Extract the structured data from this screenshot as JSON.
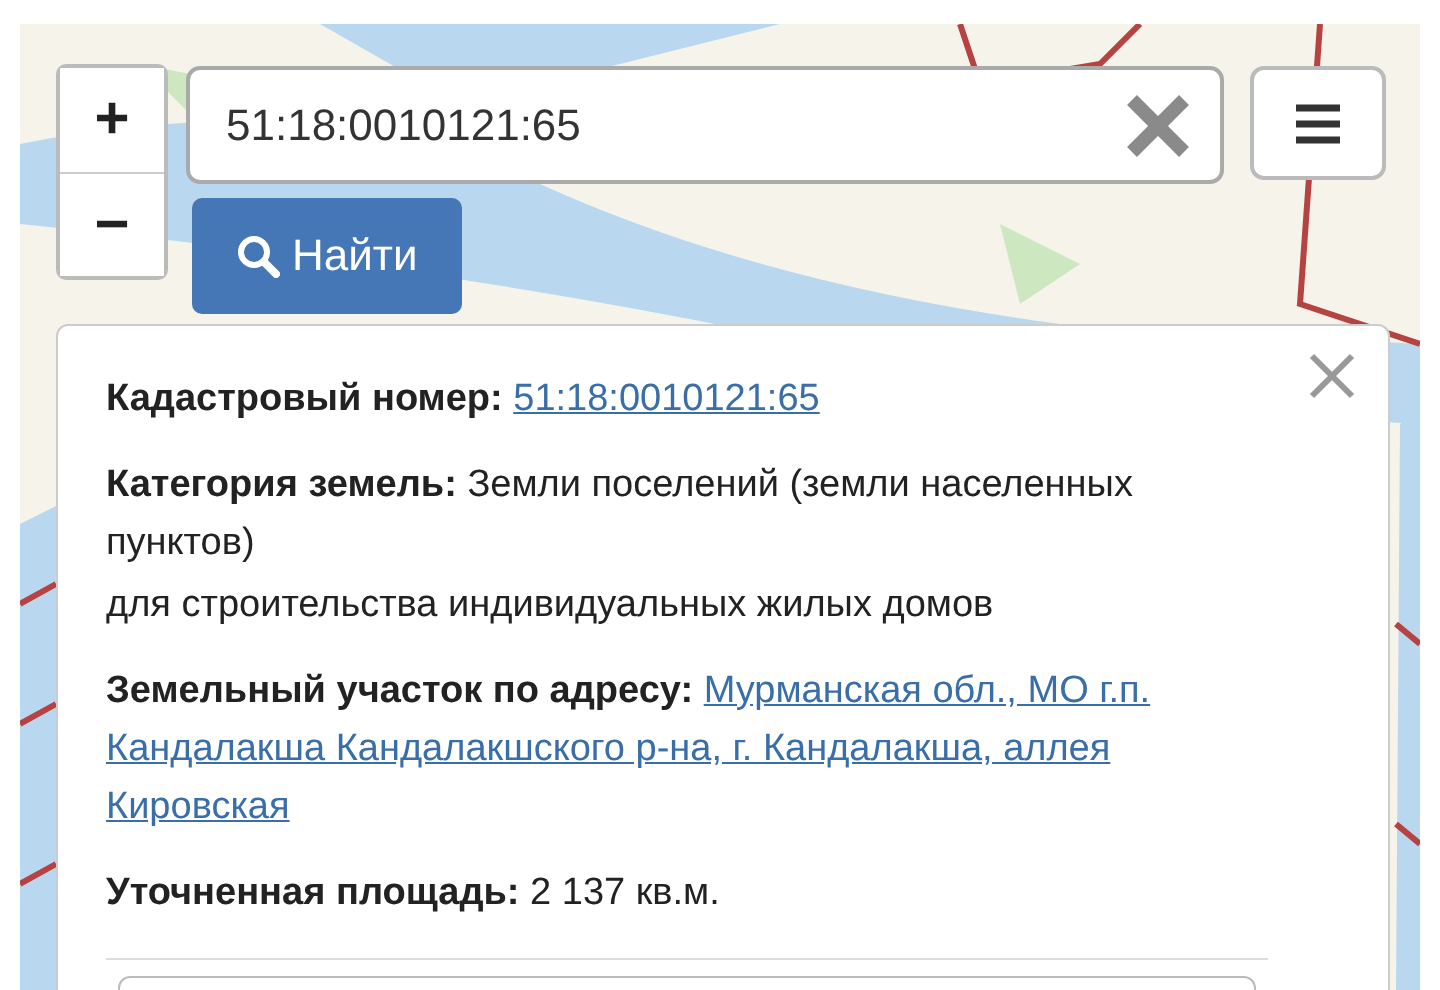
{
  "zoom": {
    "in": "+",
    "out": "−"
  },
  "search": {
    "value": "51:18:0010121:65"
  },
  "find_button": "Найти",
  "popup": {
    "fields": [
      {
        "kind": "link",
        "label": "Кадастровый номер:",
        "value_lines": [
          "51:18:0010121:65"
        ]
      },
      {
        "kind": "text",
        "label": "Категория земель:",
        "value": "Земли поселений (земли населенных пунктов)",
        "note": "для строительства индивидуальных жилых домов"
      },
      {
        "kind": "link",
        "label": "Земельный участок по адресу:",
        "value_lines": [
          "Мурманская обл., МО г.п.",
          "Кандалакша Кандалакшского р-на, г. Кандалакша, аллея",
          "Кировская"
        ]
      },
      {
        "kind": "text",
        "label": "Уточненная площадь:",
        "value": "2 137 кв.м."
      }
    ]
  }
}
